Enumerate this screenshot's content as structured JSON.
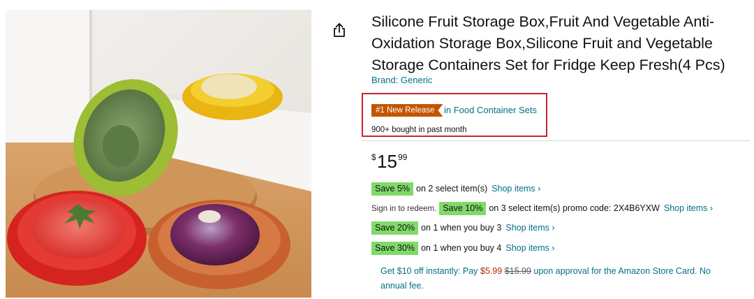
{
  "product": {
    "title": "Silicone Fruit Storage Box,Fruit And Vegetable Anti-Oxidation Storage Box,Silicone Fruit and Vegetable Storage Containers Set for Fridge Keep Fresh(4 Pcs)",
    "brand": "Brand: Generic",
    "image_alt": "Silicone fruit storage boxes with avocado, lemon, tomato and onion"
  },
  "badge": {
    "label": "#1 New Release",
    "category": "in Food Container Sets",
    "bought": "900+ bought in past month"
  },
  "price": {
    "symbol": "$",
    "whole": "15",
    "fraction": "99"
  },
  "promos": [
    {
      "chip": "Save 5%",
      "text": "on 2 select item(s)",
      "link": "Shop items ›"
    },
    {
      "prefix": "Sign in to redeem.",
      "chip": "Save 10%",
      "text": "on 3 select item(s) promo code: 2X4B6YXW",
      "link": "Shop items ›"
    },
    {
      "chip": "Save 20%",
      "text": "on 1 when you buy 3",
      "link": "Shop items ›"
    },
    {
      "chip": "Save 30%",
      "text": "on 1 when you buy 4",
      "link": "Shop items ›"
    }
  ],
  "card_offer": {
    "part1": "Get $10 off instantly: Pay ",
    "new_price": "$5.99",
    "old_price": "$15.99",
    "part2": " upon approval for the Amazon Store Card. No annual fee."
  },
  "colors": {
    "badge": "#c45500",
    "link": "#007185",
    "chip": "#7fda69",
    "highlight_border": "#c7252f"
  },
  "icons": {
    "share": "share-icon"
  }
}
